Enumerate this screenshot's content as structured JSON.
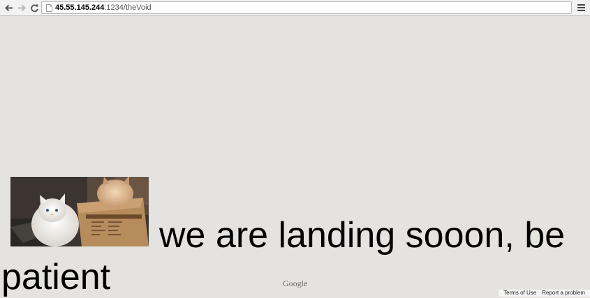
{
  "browser": {
    "url_host": "45.55.145.244",
    "url_path": ":1234/theVoid",
    "back_icon": "arrow-left-icon",
    "forward_icon": "arrow-right-icon",
    "reload_icon": "reload-icon",
    "menu_icon": "hamburger-menu-icon"
  },
  "content": {
    "image_alt": "cats in a cardboard box",
    "headline_line1": "we are landing sooon, be",
    "headline_line2": "patient"
  },
  "map_attribution": {
    "logo": "Google",
    "links": [
      "Terms of Use",
      "Report a problem"
    ]
  },
  "colors": {
    "background": "#e5e3df",
    "toolbar": "#f2f2f2"
  }
}
